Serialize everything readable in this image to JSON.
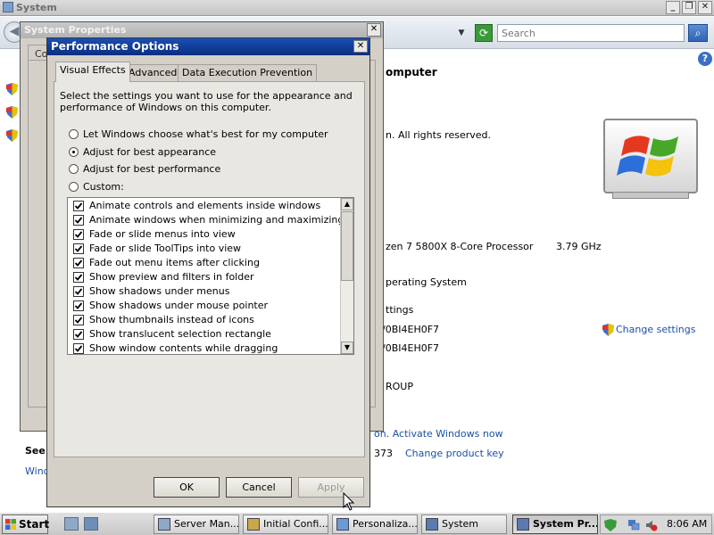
{
  "system_window": {
    "title": "System",
    "search_placeholder": "Search",
    "heading_fragment": "omputer",
    "copyright_fragment": "n.  All rights reserved.",
    "processor_fragment": "zen 7 5800X 8-Core Processor",
    "processor_speed": "3.79 GHz",
    "os_fragment": "perating System",
    "settings_fragment": "ttings",
    "computer_name_fragment": "/0BI4EH0F7",
    "full_name_fragment": "/0BI4EH0F7",
    "workgroup_fragment": "ROUP",
    "change_settings_label": "Change settings",
    "activation_fragment": "on. Activate Windows now",
    "product_id_fragment": "373",
    "change_product_key_label": "Change product key",
    "see_also_fragment": "See",
    "windows_link_fragment": "Wind"
  },
  "system_properties": {
    "title": "System Properties",
    "tab_fragment": "Co"
  },
  "performance_options": {
    "title": "Performance Options",
    "tabs": [
      {
        "label": "Visual Effects",
        "active": true
      },
      {
        "label": "Advanced",
        "active": false
      },
      {
        "label": "Data Execution Prevention",
        "active": false
      }
    ],
    "description_line1": "Select the settings you want to use for the appearance and",
    "description_line2": "performance of Windows on this computer.",
    "radio_options": [
      {
        "label": "Let Windows choose what's best for my computer",
        "checked": false
      },
      {
        "label": "Adjust for best appearance",
        "checked": true
      },
      {
        "label": "Adjust for best performance",
        "checked": false
      },
      {
        "label": "Custom:",
        "checked": false
      }
    ],
    "effects": [
      {
        "label": "Animate controls and elements inside windows",
        "checked": true
      },
      {
        "label": "Animate windows when minimizing and maximizing",
        "checked": true
      },
      {
        "label": "Fade or slide menus into view",
        "checked": true
      },
      {
        "label": "Fade or slide ToolTips into view",
        "checked": true
      },
      {
        "label": "Fade out menu items after clicking",
        "checked": true
      },
      {
        "label": "Show preview and filters in folder",
        "checked": true
      },
      {
        "label": "Show shadows under menus",
        "checked": true
      },
      {
        "label": "Show shadows under mouse pointer",
        "checked": true
      },
      {
        "label": "Show thumbnails instead of icons",
        "checked": true
      },
      {
        "label": "Show translucent selection rectangle",
        "checked": true
      },
      {
        "label": "Show window contents while dragging",
        "checked": true
      }
    ],
    "ok_label": "OK",
    "cancel_label": "Cancel",
    "apply_label": "Apply"
  },
  "taskbar": {
    "start_label": "Start",
    "tasks": [
      {
        "label": "Server Man...",
        "active": false
      },
      {
        "label": "Initial Confi...",
        "active": false
      },
      {
        "label": "Personaliza...",
        "active": false
      },
      {
        "label": "System",
        "active": false
      },
      {
        "label": "System Pr...",
        "active": true
      }
    ],
    "clock": "8:06 AM"
  },
  "colors": {
    "dialog_titlebar": "#0a2e80",
    "link": "#1c4fa8",
    "dialog_face": "#d4d0c8"
  },
  "icons": [
    "shield-icon",
    "search-icon",
    "refresh-icon",
    "help-icon",
    "close-icon",
    "windows-logo",
    "mouse-pointer"
  ]
}
